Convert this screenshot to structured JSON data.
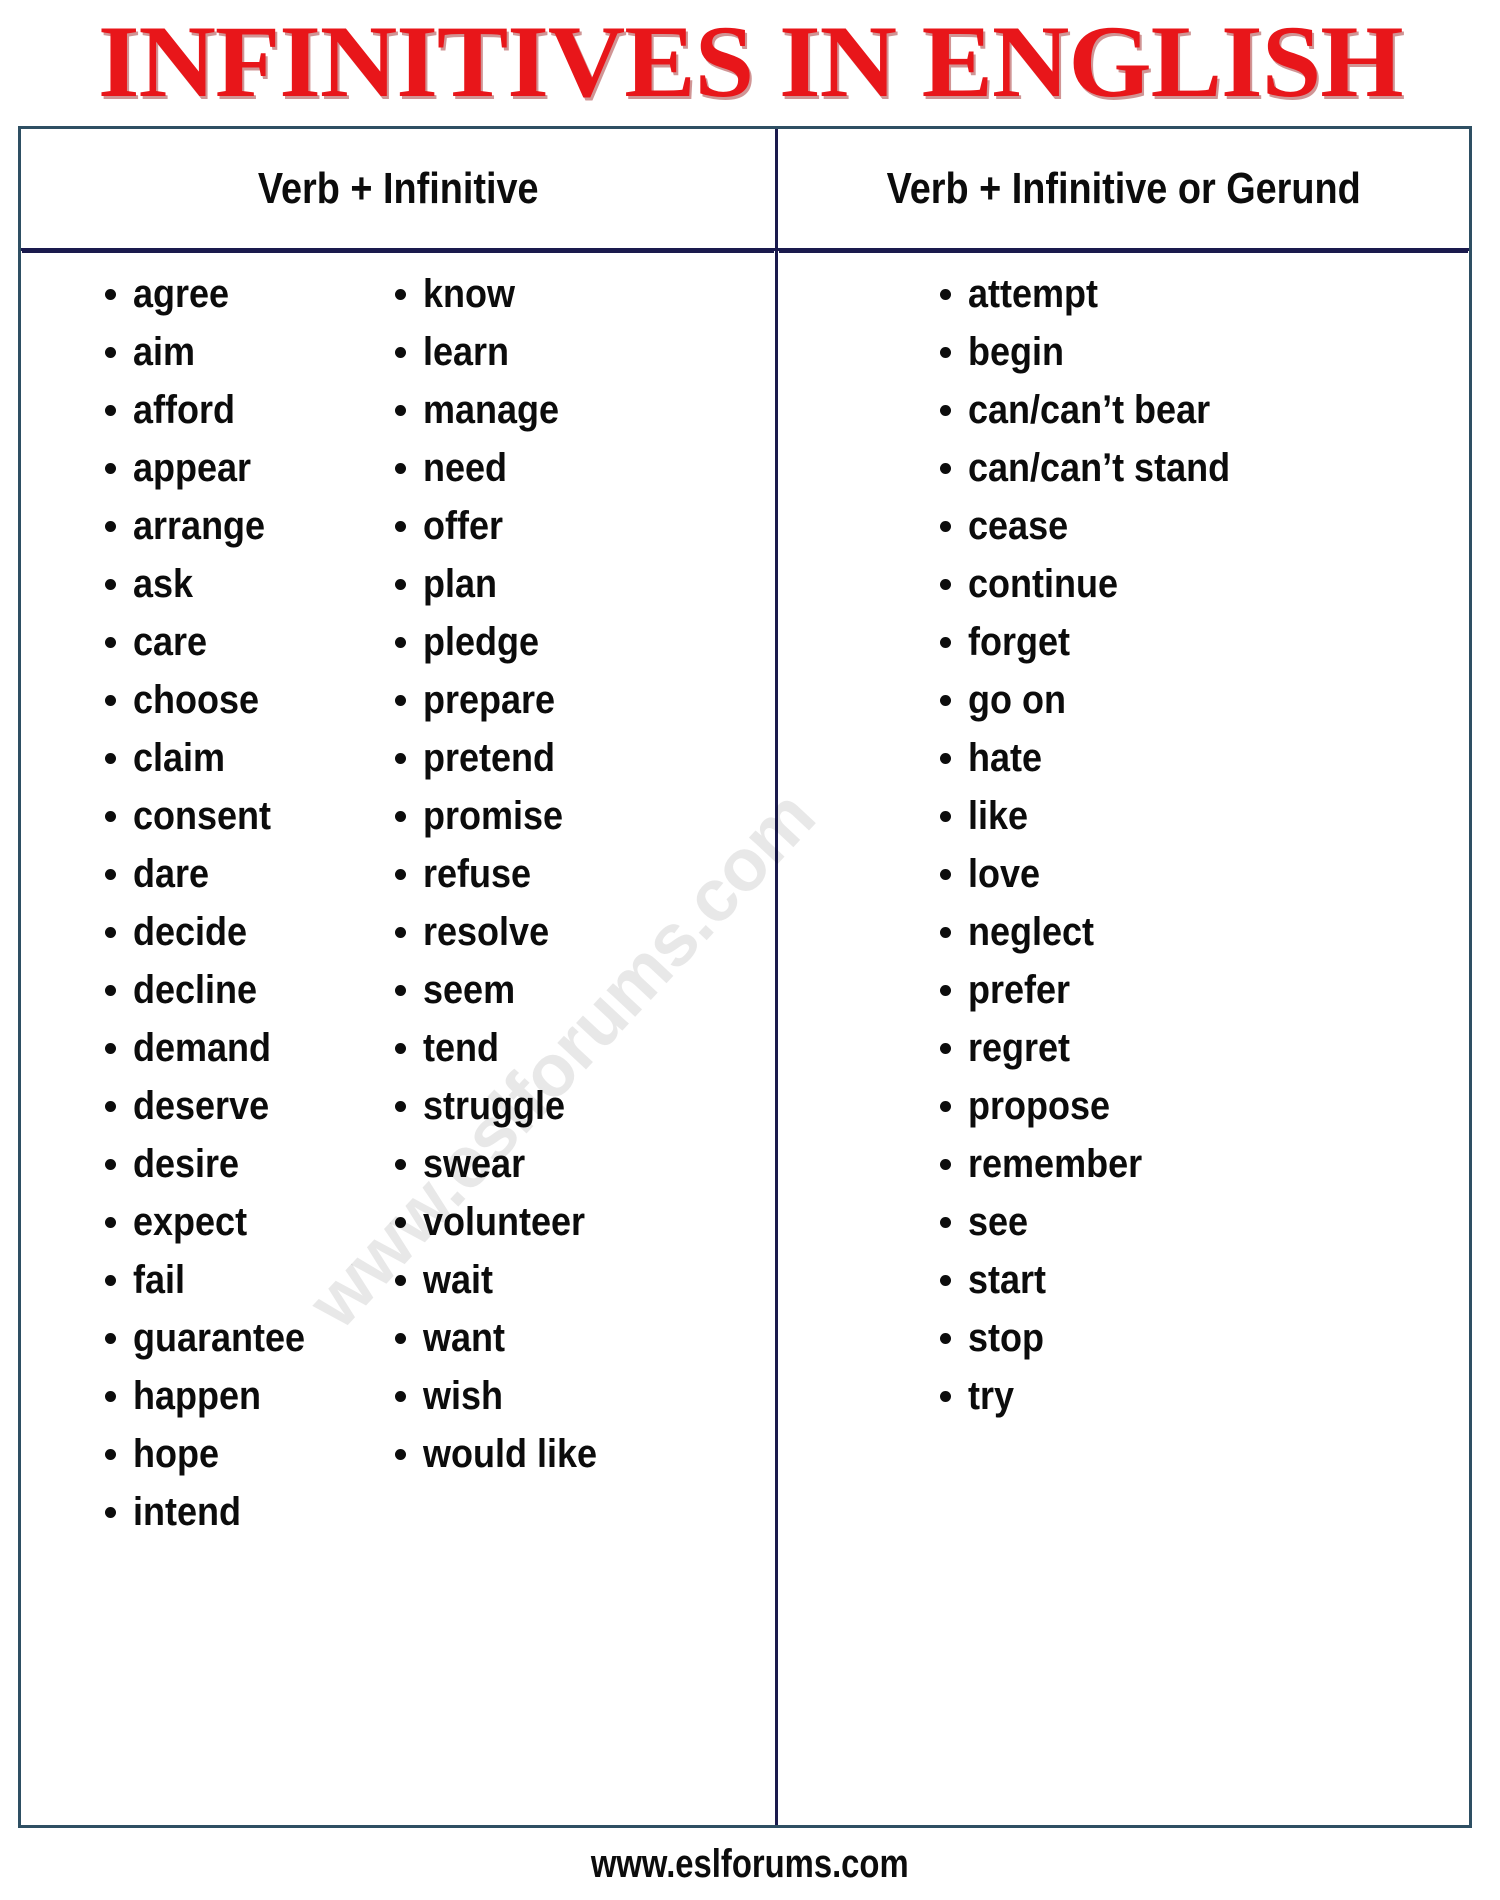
{
  "title": "INFINITIVES IN ENGLISH",
  "title_color": "#e8161a",
  "border_color": "#2e4f63",
  "divider_color": "#1a1a4d",
  "watermark": "www.eslforums.com",
  "footer": "www.eslforums.com",
  "columns": [
    {
      "header": "Verb + Infinitive",
      "sublists": [
        [
          "agree",
          "aim",
          "afford",
          "appear",
          "arrange",
          "ask",
          "care",
          "choose",
          "claim",
          "consent",
          "dare",
          "decide",
          "decline",
          "demand",
          "deserve",
          "desire",
          "expect",
          "fail",
          "guarantee",
          "happen",
          "hope",
          "intend"
        ],
        [
          "know",
          "learn",
          "manage",
          "need",
          "offer",
          "plan",
          "pledge",
          "prepare",
          "pretend",
          "promise",
          "refuse",
          "resolve",
          "seem",
          "tend",
          "struggle",
          "swear",
          "volunteer",
          "wait",
          "want",
          "wish",
          "would like"
        ]
      ]
    },
    {
      "header": "Verb + Infinitive or Gerund",
      "sublists": [
        [
          "attempt",
          "begin",
          "can/can’t bear",
          "can/can’t stand",
          "cease",
          "continue",
          "forget",
          "go on",
          "hate",
          "like",
          "love",
          "neglect",
          "prefer",
          "regret",
          "propose",
          "remember",
          "see",
          "start",
          "stop",
          "try"
        ]
      ]
    }
  ]
}
